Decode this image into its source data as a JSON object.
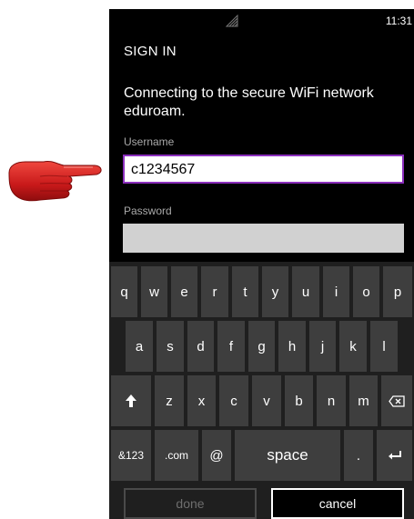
{
  "status": {
    "time": "11:31"
  },
  "page": {
    "title": "SIGN IN",
    "description": "Connecting to the secure WiFi network eduroam."
  },
  "form": {
    "username_label": "Username",
    "username_value": "c1234567",
    "password_label": "Password",
    "password_value": ""
  },
  "keyboard": {
    "row1": [
      "q",
      "w",
      "e",
      "r",
      "t",
      "y",
      "u",
      "i",
      "o",
      "p"
    ],
    "row2": [
      "a",
      "s",
      "d",
      "f",
      "g",
      "h",
      "j",
      "k",
      "l"
    ],
    "row3": [
      "z",
      "x",
      "c",
      "v",
      "b",
      "n",
      "m"
    ],
    "symbols": "&123",
    "dotcom": ".com",
    "at": "@",
    "space": "space",
    "period": ".",
    "done": "done",
    "cancel": "cancel"
  },
  "icons": {
    "pointer": "red-pointing-hand-icon",
    "signal": "signal-strength-icon",
    "shift": "shift-arrow-icon",
    "backspace": "backspace-icon",
    "enter": "enter-icon"
  },
  "colors": {
    "focus_border": "#8b2fbd",
    "pointer": "#d9231c",
    "key": "#3e3e3e",
    "keyboard_bg": "#1f1f1f"
  }
}
